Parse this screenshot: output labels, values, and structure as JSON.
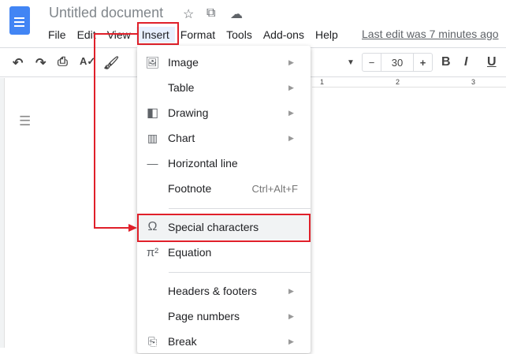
{
  "header": {
    "title": "Untitled document",
    "last_edit": "Last edit was 7 minutes ago"
  },
  "menubar": [
    "File",
    "Edit",
    "View",
    "Insert",
    "Format",
    "Tools",
    "Add-ons",
    "Help"
  ],
  "toolbar": {
    "font_size": "30",
    "minus": "−",
    "plus": "+",
    "bold": "B",
    "italic": "I",
    "underline": "U"
  },
  "ruler": {
    "marks": [
      "1",
      "2",
      "3"
    ]
  },
  "insert_menu": {
    "items": [
      {
        "label": "Image",
        "icon": "image-icon",
        "submenu": true
      },
      {
        "label": "Table",
        "icon": "",
        "submenu": true
      },
      {
        "label": "Drawing",
        "icon": "drawing-icon",
        "submenu": true
      },
      {
        "label": "Chart",
        "icon": "chart-icon",
        "submenu": true
      },
      {
        "label": "Horizontal line",
        "icon": "horizontal-line-icon",
        "submenu": false
      },
      {
        "label": "Footnote",
        "icon": "",
        "shortcut": "Ctrl+Alt+F",
        "submenu": false
      },
      {
        "label": "Special characters",
        "icon": "omega-icon",
        "submenu": false,
        "highlighted": true
      },
      {
        "label": "Equation",
        "icon": "pi-icon",
        "submenu": false
      },
      {
        "label": "Headers & footers",
        "icon": "",
        "submenu": true
      },
      {
        "label": "Page numbers",
        "icon": "",
        "submenu": true
      },
      {
        "label": "Break",
        "icon": "break-icon",
        "submenu": true
      }
    ]
  },
  "colors": {
    "annotation": "#e0202a",
    "highlight": "#f1f3f4",
    "docs_blue": "#4285f4"
  }
}
